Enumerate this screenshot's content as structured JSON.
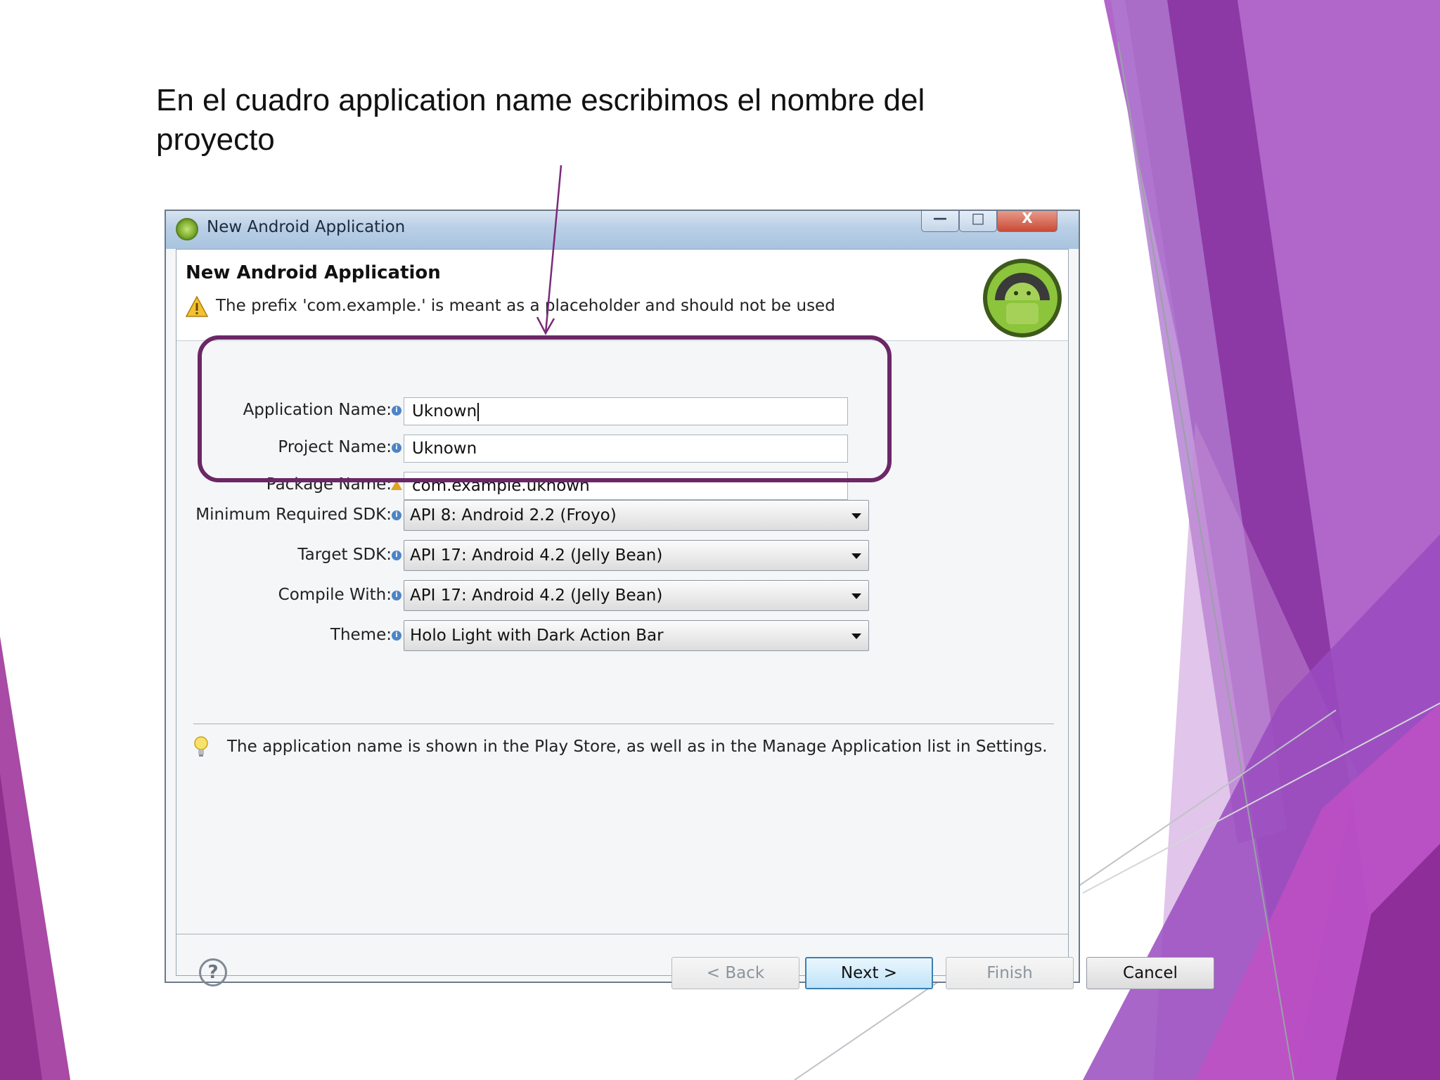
{
  "slide": {
    "title": "En el cuadro application name escribimos el nombre del proyecto"
  },
  "window": {
    "title": "New Android Application",
    "controls": {
      "minimize": "—",
      "maximize": "□",
      "close": "X"
    }
  },
  "banner": {
    "title": "New Android Application",
    "message": "The prefix 'com.example.' is meant as a placeholder and should not be used"
  },
  "form": {
    "application_name": {
      "label": "Application Name:",
      "value": "Uknown"
    },
    "project_name": {
      "label": "Project Name:",
      "value": "Uknown"
    },
    "package_name": {
      "label": "Package Name:",
      "value": "com.example.uknown"
    },
    "min_sdk": {
      "label": "Minimum Required SDK:",
      "value": "API 8: Android 2.2 (Froyo)"
    },
    "target_sdk": {
      "label": "Target SDK:",
      "value": "API 17: Android 4.2 (Jelly Bean)"
    },
    "compile_with": {
      "label": "Compile With:",
      "value": "API 17: Android 4.2 (Jelly Bean)"
    },
    "theme": {
      "label": "Theme:",
      "value": "Holo Light with Dark Action Bar"
    }
  },
  "hint": "The application name is shown in the Play Store, as well as in the Manage Application list in Settings.",
  "buttons": {
    "help": "?",
    "back": "< Back",
    "next": "Next >",
    "finish": "Finish",
    "cancel": "Cancel"
  },
  "colors": {
    "highlight": "#6b2766",
    "arrow": "#7b2a7a",
    "accent_purple": "#8e3ea8"
  }
}
